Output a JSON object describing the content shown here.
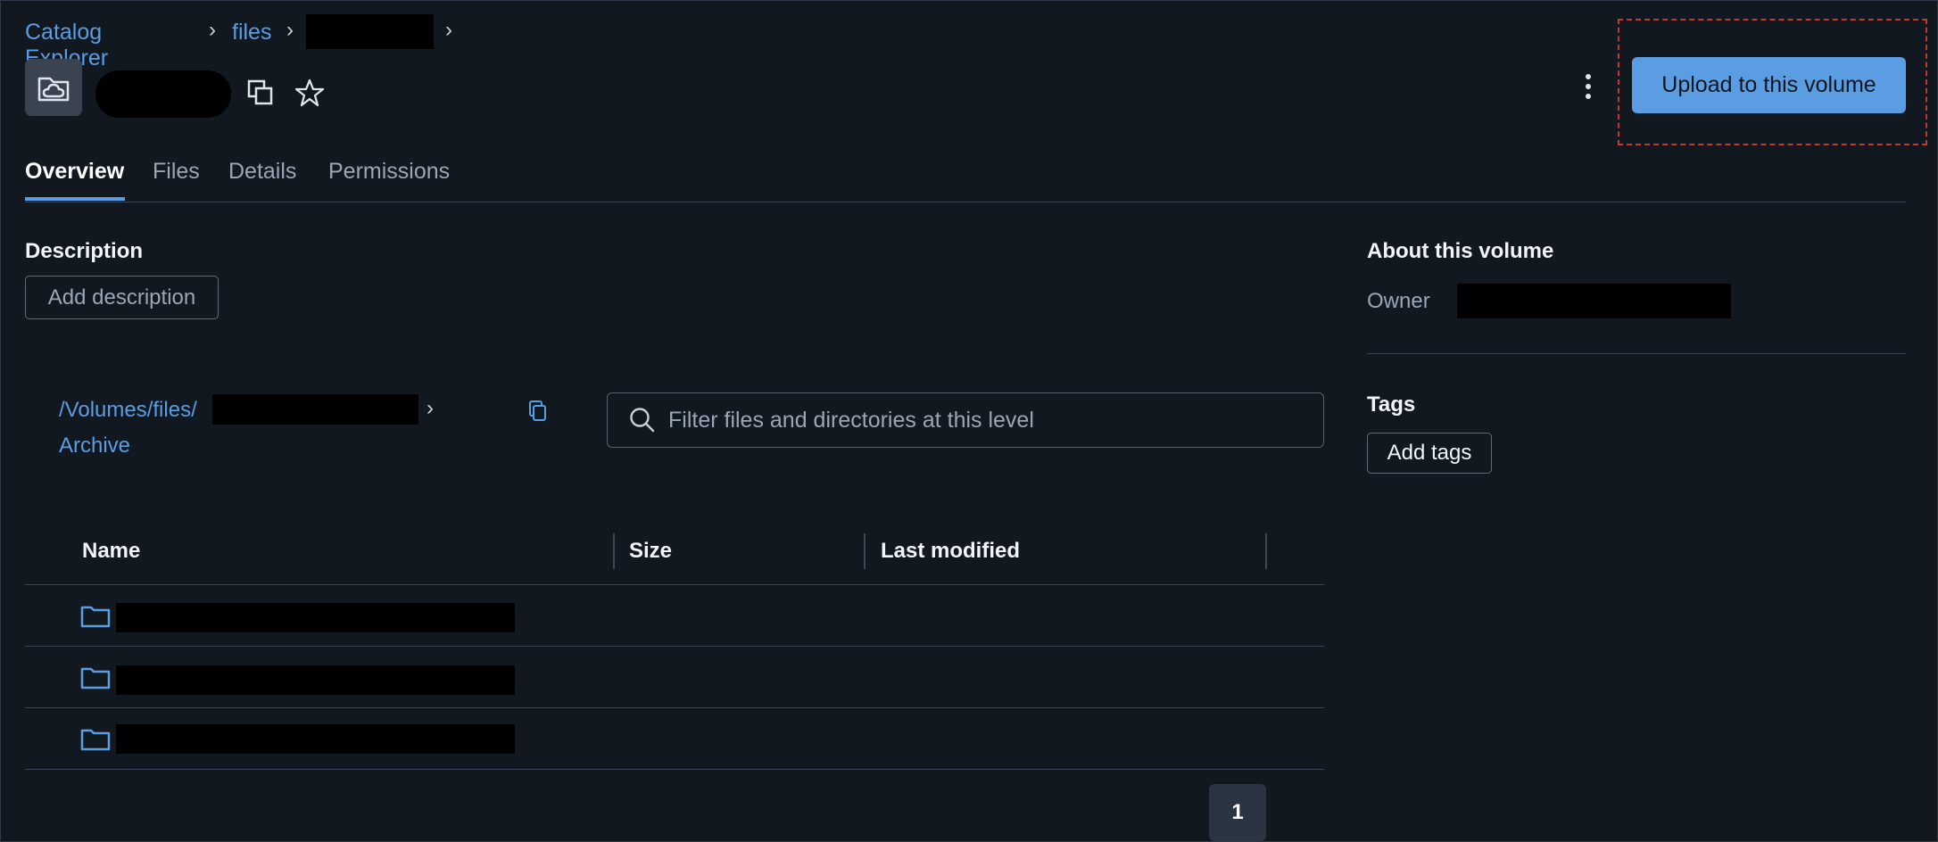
{
  "breadcrumb": {
    "items": [
      "Catalog Explorer",
      "files"
    ]
  },
  "header": {
    "upload_label": "Upload to this volume"
  },
  "tabs": [
    "Overview",
    "Files",
    "Details",
    "Permissions"
  ],
  "description": {
    "title": "Description",
    "add_label": "Add description"
  },
  "path": {
    "prefix": "/Volumes/files/",
    "second_line": "Archive"
  },
  "search": {
    "placeholder": "Filter files and directories at this level"
  },
  "table": {
    "columns": [
      "Name",
      "Size",
      "Last modified"
    ],
    "row_count": 3
  },
  "pagination": {
    "current": "1"
  },
  "about": {
    "title": "About this volume",
    "owner_label": "Owner"
  },
  "tags": {
    "title": "Tags",
    "add_label": "Add tags"
  },
  "colors": {
    "accent": "#5b9de2",
    "background": "#121820",
    "highlight": "#c0392b"
  },
  "icons": [
    "volume-cloud-icon",
    "copy-icon",
    "star-icon",
    "kebab-menu-icon",
    "search-icon",
    "folder-icon"
  ]
}
